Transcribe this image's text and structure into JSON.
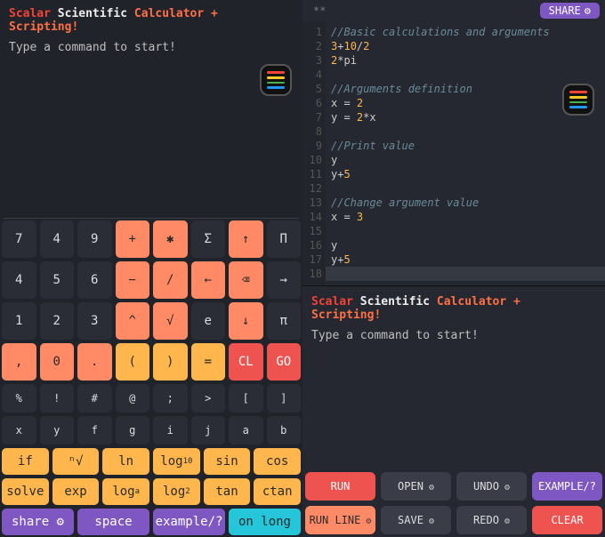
{
  "title": {
    "w1": "Scalar",
    "w2": "Scientific",
    "w3": "Calculator + Scripting!"
  },
  "prompt": "Type a command to start!",
  "share_label": "SHARE",
  "editor_marker": "**",
  "code_lines": [
    {
      "n": 1,
      "type": "comment",
      "text": "//Basic calculations and arguments"
    },
    {
      "n": 2,
      "type": "expr",
      "tokens": [
        {
          "t": "3",
          "c": "num"
        },
        {
          "t": "+",
          "c": "op"
        },
        {
          "t": "10",
          "c": "num"
        },
        {
          "t": "/",
          "c": "op"
        },
        {
          "t": "2",
          "c": "num"
        }
      ]
    },
    {
      "n": 3,
      "type": "expr",
      "tokens": [
        {
          "t": "2",
          "c": "num"
        },
        {
          "t": "*",
          "c": "op"
        },
        {
          "t": "pi",
          "c": "id"
        }
      ]
    },
    {
      "n": 4,
      "type": "blank"
    },
    {
      "n": 5,
      "type": "comment",
      "text": "//Arguments definition"
    },
    {
      "n": 6,
      "type": "expr",
      "tokens": [
        {
          "t": "x ",
          "c": "id"
        },
        {
          "t": "= ",
          "c": "op"
        },
        {
          "t": "2",
          "c": "num"
        }
      ]
    },
    {
      "n": 7,
      "type": "expr",
      "tokens": [
        {
          "t": "y ",
          "c": "id"
        },
        {
          "t": "= ",
          "c": "op"
        },
        {
          "t": "2",
          "c": "num"
        },
        {
          "t": "*",
          "c": "op"
        },
        {
          "t": "x",
          "c": "id"
        }
      ]
    },
    {
      "n": 8,
      "type": "blank"
    },
    {
      "n": 9,
      "type": "comment",
      "text": "//Print value"
    },
    {
      "n": 10,
      "type": "expr",
      "tokens": [
        {
          "t": "y",
          "c": "id"
        }
      ]
    },
    {
      "n": 11,
      "type": "expr",
      "tokens": [
        {
          "t": "y",
          "c": "id"
        },
        {
          "t": "+",
          "c": "op"
        },
        {
          "t": "5",
          "c": "num"
        }
      ]
    },
    {
      "n": 12,
      "type": "blank"
    },
    {
      "n": 13,
      "type": "comment",
      "text": "//Change argument value"
    },
    {
      "n": 14,
      "type": "expr",
      "tokens": [
        {
          "t": "x ",
          "c": "id"
        },
        {
          "t": "= ",
          "c": "op"
        },
        {
          "t": "3",
          "c": "num"
        }
      ]
    },
    {
      "n": 15,
      "type": "blank"
    },
    {
      "n": 16,
      "type": "expr",
      "tokens": [
        {
          "t": "y",
          "c": "id"
        }
      ]
    },
    {
      "n": 17,
      "type": "expr",
      "tokens": [
        {
          "t": "y",
          "c": "id"
        },
        {
          "t": "+",
          "c": "op"
        },
        {
          "t": "5",
          "c": "num"
        }
      ]
    },
    {
      "n": 18,
      "type": "blank"
    }
  ],
  "keypad": [
    {
      "cls": "",
      "keys": [
        {
          "l": "7"
        },
        {
          "l": "4"
        },
        {
          "l": "9"
        },
        {
          "l": "+",
          "c": "k-orange"
        },
        {
          "l": "✱",
          "c": "k-orange"
        },
        {
          "l": "Σ"
        },
        {
          "l": "↑",
          "c": "k-orange"
        },
        {
          "l": "Π"
        }
      ]
    },
    {
      "cls": "",
      "keys": [
        {
          "l": "4"
        },
        {
          "l": "5"
        },
        {
          "l": "6"
        },
        {
          "l": "−",
          "c": "k-orange"
        },
        {
          "l": "/",
          "c": "k-orange"
        },
        {
          "l": "←",
          "c": "k-orange"
        },
        {
          "l": "⌫",
          "c": "k-orange"
        },
        {
          "l": "→"
        }
      ]
    },
    {
      "cls": "",
      "keys": [
        {
          "l": "1"
        },
        {
          "l": "2"
        },
        {
          "l": "3"
        },
        {
          "l": "^",
          "c": "k-orange"
        },
        {
          "l": "√",
          "c": "k-orange"
        },
        {
          "l": "e"
        },
        {
          "l": "↓",
          "c": "k-orange"
        },
        {
          "l": "π"
        }
      ]
    },
    {
      "cls": "",
      "keys": [
        {
          "l": ",",
          "c": "k-orange"
        },
        {
          "l": "0",
          "c": "k-orange"
        },
        {
          "l": ".",
          "c": "k-orange"
        },
        {
          "l": "(",
          "c": "k-yellow"
        },
        {
          "l": ")",
          "c": "k-yellow"
        },
        {
          "l": "=",
          "c": "k-yellow"
        },
        {
          "l": "CL",
          "c": "k-red"
        },
        {
          "l": "GO",
          "c": "k-red"
        }
      ]
    },
    {
      "cls": "short",
      "keys": [
        {
          "l": "%"
        },
        {
          "l": "!"
        },
        {
          "l": "#"
        },
        {
          "l": "@"
        },
        {
          "l": ";"
        },
        {
          "l": ">"
        },
        {
          "l": "["
        },
        {
          "l": "]"
        }
      ]
    },
    {
      "cls": "short",
      "keys": [
        {
          "l": "x"
        },
        {
          "l": "y"
        },
        {
          "l": "f"
        },
        {
          "l": "g"
        },
        {
          "l": "i"
        },
        {
          "l": "j"
        },
        {
          "l": "a"
        },
        {
          "l": "b"
        }
      ]
    },
    {
      "cls": "fun",
      "keys": [
        {
          "l": "if",
          "c": "k-yellow"
        },
        {
          "l": "ⁿ√",
          "c": "k-yellow"
        },
        {
          "l": "ln",
          "c": "k-yellow"
        },
        {
          "l": "log<sub>10</sub>",
          "c": "k-yellow"
        },
        {
          "l": "sin",
          "c": "k-yellow"
        },
        {
          "l": "cos",
          "c": "k-yellow"
        }
      ]
    },
    {
      "cls": "fun",
      "keys": [
        {
          "l": "solve",
          "c": "k-yellow"
        },
        {
          "l": "exp",
          "c": "k-yellow"
        },
        {
          "l": "log<sub>a</sub>",
          "c": "k-yellow"
        },
        {
          "l": "log<sub>2</sub>",
          "c": "k-yellow"
        },
        {
          "l": "tan",
          "c": "k-yellow"
        },
        {
          "l": "ctan",
          "c": "k-yellow"
        }
      ]
    },
    {
      "cls": "fun",
      "keys": [
        {
          "l": "share ⚙",
          "c": "k-purple"
        },
        {
          "l": "space",
          "c": "k-purple"
        },
        {
          "l": "example/?",
          "c": "k-purple"
        },
        {
          "l": "on long",
          "c": "k-teal"
        }
      ]
    }
  ],
  "action_rows": [
    [
      {
        "l": "RUN",
        "c": "b-red"
      },
      {
        "l": "OPEN",
        "c": "",
        "g": true
      },
      {
        "l": "UNDO",
        "c": "",
        "g": true
      },
      {
        "l": "EXAMPLE/?",
        "c": "b-purple"
      }
    ],
    [
      {
        "l": "RUN LINE",
        "c": "b-orange",
        "g": true
      },
      {
        "l": "SAVE",
        "c": "",
        "g": true
      },
      {
        "l": "REDO",
        "c": "",
        "g": true
      },
      {
        "l": "CLEAR",
        "c": "b-red"
      }
    ]
  ]
}
